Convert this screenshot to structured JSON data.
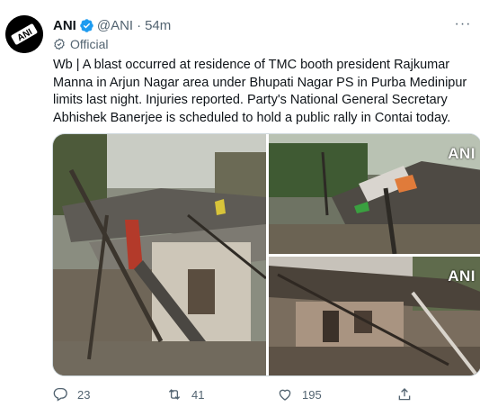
{
  "tweet": {
    "display_name": "ANI",
    "handle": "@ANI",
    "separator": "·",
    "time": "54m",
    "official_label": "Official",
    "more_glyph": "···",
    "text_lines": [
      "Wb | A blast occurred at residence of TMC booth president Rajkumar",
      "Manna in Arjun Nagar area under Bhupati Nagar PS in Purba Medinipur",
      "limits last night. Injuries reported. Party's National General Secretary",
      "Abhishek Banerjee is scheduled to hold a public rally in Contai today."
    ],
    "avatar_logo": "ANI",
    "media": {
      "watermark_b": "ANI",
      "watermark_c": "ANI"
    },
    "actions": {
      "replies": "23",
      "retweets": "41",
      "likes": "195"
    }
  },
  "icons": [
    "verified-badge-icon",
    "official-icon",
    "more-icon",
    "reply-icon",
    "retweet-icon",
    "like-icon",
    "share-icon"
  ],
  "colors": {
    "verified_blue": "#1d9bf0",
    "secondary_text": "#536471",
    "primary_text": "#0f1419",
    "border": "#cfd9de"
  }
}
